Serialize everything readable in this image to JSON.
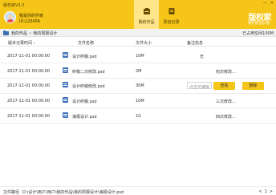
{
  "app": {
    "title": "版权家V3.0"
  },
  "window": {
    "min_symbol": "—",
    "close_symbol": "✕"
  },
  "user": {
    "name": "我是你的作家",
    "id": "ID:123456"
  },
  "nav": {
    "tabs": [
      {
        "label": "我的作品",
        "icon": "works-icon",
        "active": true
      },
      {
        "label": "原创记录",
        "icon": "records-icon",
        "active": false
      }
    ]
  },
  "brand": {
    "logo_text": "版权家",
    "slogan": "保护原创价值"
  },
  "breadcrumb": {
    "root": "我的作品",
    "current": "我的周报设计"
  },
  "usage": {
    "text": "已占用空间100M"
  },
  "table": {
    "columns": [
      "版本记录时间",
      "文件名称",
      "文件大小",
      "备注信息"
    ],
    "rows": [
      {
        "time": "2017-11-01 00:00:00",
        "file": "设计终稿.psd",
        "size": "10M",
        "note": "无"
      },
      {
        "time": "2017-11-01 00:00:00",
        "file": "终稿二次修改.psd",
        "size": "2M",
        "note": "初次修改..."
      },
      {
        "time": "2017-11-01 00:00:00",
        "file": "设计终稿修改.psd",
        "size": "30M",
        "note": "",
        "note_placeholder": "点击可编辑",
        "note_side": "修改",
        "actions": [
          "查看",
          "删除"
        ]
      },
      {
        "time": "2017-11-01 00:00:00",
        "file": "设计终稿.psd",
        "size": "10M",
        "note": "三次修改..."
      },
      {
        "time": "2017-11-01 00:00:00",
        "file": "海报设计.psd",
        "size": "1G",
        "note": "四次修改..."
      }
    ]
  },
  "footer": {
    "label": "文件路径",
    "path": "D:\\设计\\用户\\用户\\我的作品\\我的周报设计\\海报设计.psd",
    "pager": {
      "prev": "<",
      "page": "1",
      "next": ">"
    }
  },
  "colors": {
    "accent": "#f5c518",
    "accent_light": "#ffe48a",
    "file_icon": "#3d6fb6"
  }
}
